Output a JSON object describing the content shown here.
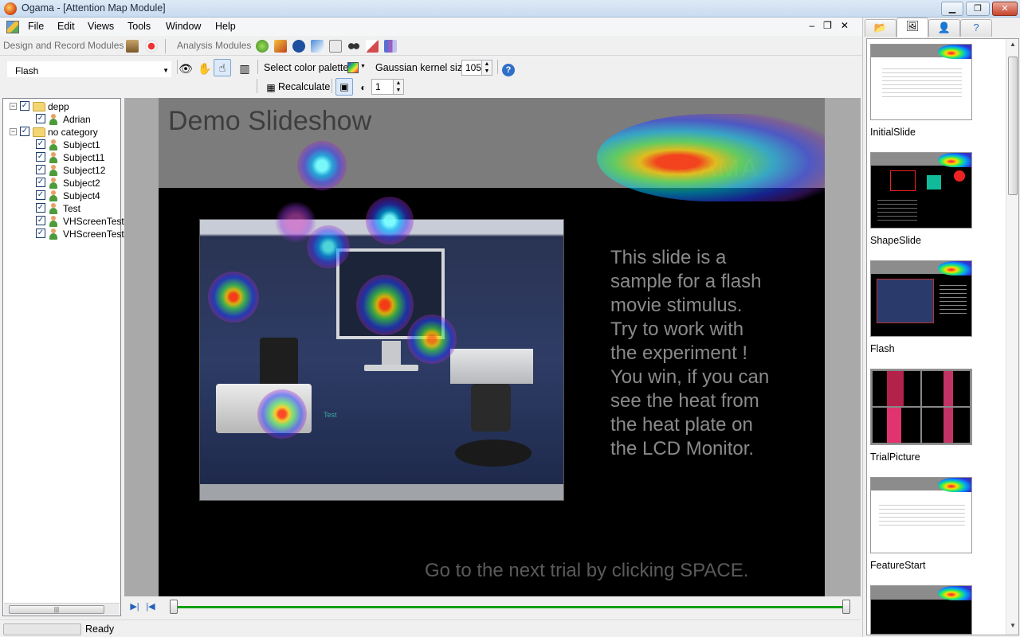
{
  "window": {
    "title": "Ogama - [Attention Map Module]"
  },
  "menu": {
    "items": [
      "File",
      "Edit",
      "Views",
      "Tools",
      "Window",
      "Help"
    ]
  },
  "modules": {
    "design_label": "Design and Record Modules",
    "analysis_label": "Analysis Modules"
  },
  "toolstrip": {
    "selected_subject": "Flash",
    "palette_label": "Select color palette",
    "kernel_label": "Gaussian kernel size",
    "kernel_value": "105",
    "recalculate_label": "Recalculate",
    "count_value": "1"
  },
  "tree": {
    "groups": [
      {
        "name": "depp",
        "subjects": [
          "Adrian"
        ]
      },
      {
        "name": "no category",
        "subjects": [
          "Subject1",
          "Subject11",
          "Subject12",
          "Subject2",
          "Subject4",
          "Test",
          "VHScreenTest",
          "VHScreenTest."
        ]
      }
    ]
  },
  "slide": {
    "title": "Demo Slideshow",
    "logo_text": "OGAMA",
    "body_text": "This slide is a sample for a flash movie stimulus! Try to work with the experiment ! You win, if you can see the heat from the heat plate on the LCD Monitor.",
    "body_lines": [
      "This slide is a",
      "sample for a flash",
      "movie stimulus.",
      "Try to work with",
      "the experiment !",
      "You win, if you can",
      "see the heat from",
      "the heat plate on",
      "the LCD Monitor."
    ],
    "footer_text": "Go to the next trial by clicking SPACE.",
    "in_photo_label": "Test"
  },
  "status": {
    "text": "Ready"
  },
  "slides_panel": {
    "slides": [
      "InitialSlide",
      "ShapeSlide",
      "Flash",
      "TrialPicture",
      "FeatureStart"
    ]
  },
  "colors": {
    "title_bar": "#c9dcf0",
    "timeline_track": "#11a011",
    "slide_background": "#000000",
    "slide_header": "#7c7c7c"
  }
}
